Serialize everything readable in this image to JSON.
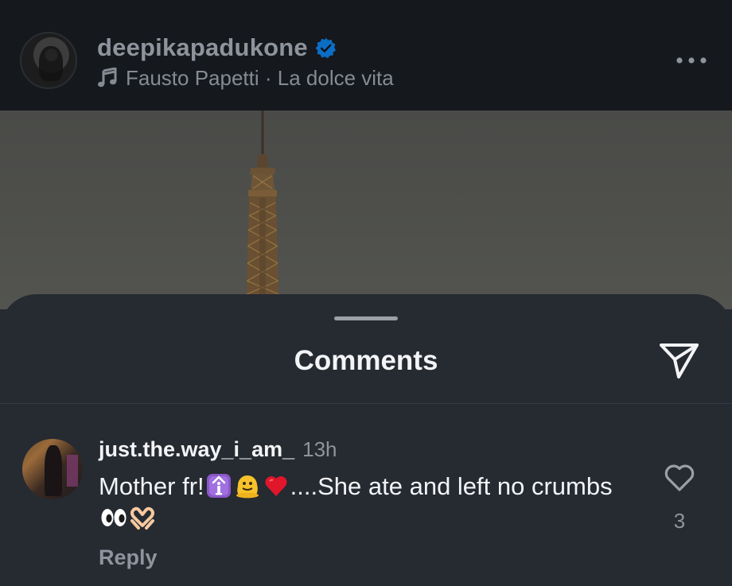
{
  "post": {
    "username": "deepikapadukone",
    "verified_icon": "verified-badge-icon",
    "music_icon": "music-note-icon",
    "music": "Fausto Papetti · La dolce vita",
    "more_icon": "more-options-icon"
  },
  "sheet": {
    "title": "Comments",
    "share_icon": "send-icon"
  },
  "comment": {
    "username": "just.the.way_i_am_",
    "time": "13h",
    "text_part1": "Mother fr!",
    "emojis_1": [
      "information-emoji",
      "melting-face-emoji",
      "red-heart-emoji"
    ],
    "text_part2": "....She ate and left no crumbs",
    "emojis_2": [
      "eyes-emoji",
      "heart-hands-emoji"
    ],
    "reply_label": "Reply",
    "like_icon": "heart-outline-icon",
    "like_count": "3"
  },
  "colors": {
    "header_bg": "#15181c",
    "sheet_bg": "#262a31",
    "verified_blue": "#0095f6",
    "text_primary": "#f2f4f6",
    "text_secondary": "#8e949d"
  }
}
